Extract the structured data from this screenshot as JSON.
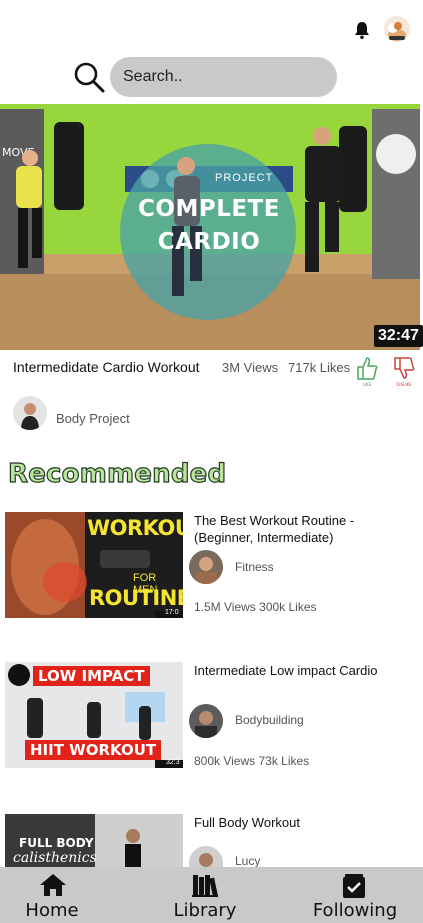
{
  "header": {
    "search_placeholder": "Search..",
    "icons": [
      "bell-icon",
      "user-avatar",
      "search-icon"
    ]
  },
  "hero": {
    "overlay_line1": "COMPLETE",
    "overlay_line2": "CARDIO",
    "banner_text": "PROJECT",
    "duration": "32:47",
    "title": "Intermedidate Cardio Workout",
    "views": "3M Views",
    "likes": "717k Likes",
    "like_label": "LIKE",
    "dislike_label": "DISLIKE",
    "channel": "Body Project"
  },
  "section": {
    "recommended": "Recommended"
  },
  "recommended": [
    {
      "title": "The Best Workout Routine - (Beginner, Intermediate)",
      "thumb_text1": "WORKOUT",
      "thumb_text2": "FOR MEN",
      "thumb_text3": "ROUTINE",
      "thumb_time": "17:0",
      "channel": "Fitness",
      "stats": "1.5M Views  300k Likes"
    },
    {
      "title": "Intermediate Low impact Cardio",
      "thumb_text1": "LOW IMPACT",
      "thumb_text2": "HIIT WORKOUT",
      "thumb_time": "32:3",
      "channel": "Bodybuilding",
      "stats": "800k Views  73k Likes"
    },
    {
      "title": "Full Body Workout",
      "thumb_text1": "FULL BODY",
      "thumb_text2": "calisthenics",
      "channel": "Lucy"
    }
  ],
  "nav": {
    "home": "Home",
    "library": "Library",
    "following": "Following"
  },
  "colors": {
    "search_bg": "#c9c9c9",
    "nav_bg": "#c9c9c9",
    "recommended_fill": "#b9e39e",
    "like_green": "#4aa35e",
    "dislike_red": "#c9453d"
  }
}
